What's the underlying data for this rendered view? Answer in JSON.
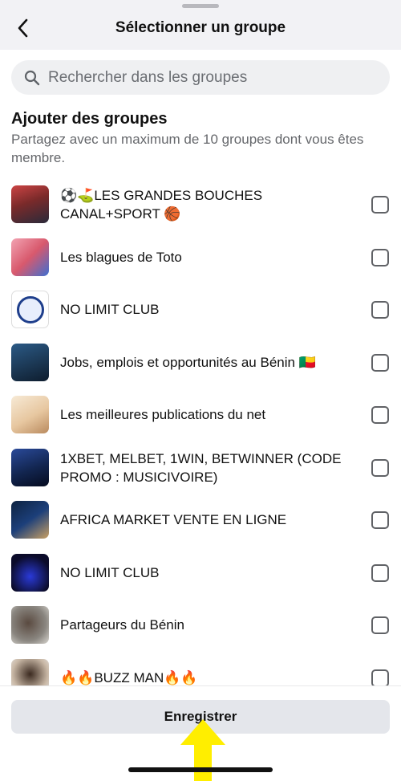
{
  "header": {
    "title": "Sélectionner un groupe",
    "back_icon": "chevron-left-icon"
  },
  "search": {
    "placeholder": "Rechercher dans les groupes",
    "icon": "search-icon"
  },
  "section": {
    "title": "Ajouter des groupes",
    "subtitle": "Partagez avec un maximum de 10 groupes dont vous êtes membre."
  },
  "groups": [
    {
      "name": "⚽️⛳️LES GRANDES BOUCHES CANAL+SPORT 🏀",
      "checked": false,
      "thumb_color": "#b23b3b"
    },
    {
      "name": "Les blagues de Toto",
      "checked": false,
      "thumb_color": "#d8596d"
    },
    {
      "name": "NO LIMIT CLUB",
      "checked": false,
      "thumb_color": "#1f3f8c"
    },
    {
      "name": "Jobs, emplois et opportunités au Bénin 🇧🇯",
      "checked": false,
      "thumb_color": "#1a3550"
    },
    {
      "name": "Les meilleures publications du net",
      "checked": false,
      "thumb_color": "#e7c7a0"
    },
    {
      "name": "1XBET, MELBET, 1WIN, BETWINNER (CODE PROMO : MUSICIVOIRE)",
      "checked": false,
      "thumb_color": "#12254f"
    },
    {
      "name": "AFRICA MARKET VENTE EN LIGNE",
      "checked": false,
      "thumb_color": "#1c3f7a"
    },
    {
      "name": "NO LIMIT CLUB",
      "checked": false,
      "thumb_color": "#0b0b2a"
    },
    {
      "name": "Partageurs du Bénin",
      "checked": false,
      "thumb_color": "#8a8680"
    },
    {
      "name": "🔥🔥BUZZ MAN🔥🔥",
      "checked": false,
      "thumb_color": "#c9b8a6"
    }
  ],
  "footer": {
    "save_label": "Enregistrer"
  },
  "colors": {
    "header_bg": "#f2f2f5",
    "search_bg": "#eff0f2",
    "button_bg": "#e4e6eb",
    "arrow": "#ffee00"
  }
}
